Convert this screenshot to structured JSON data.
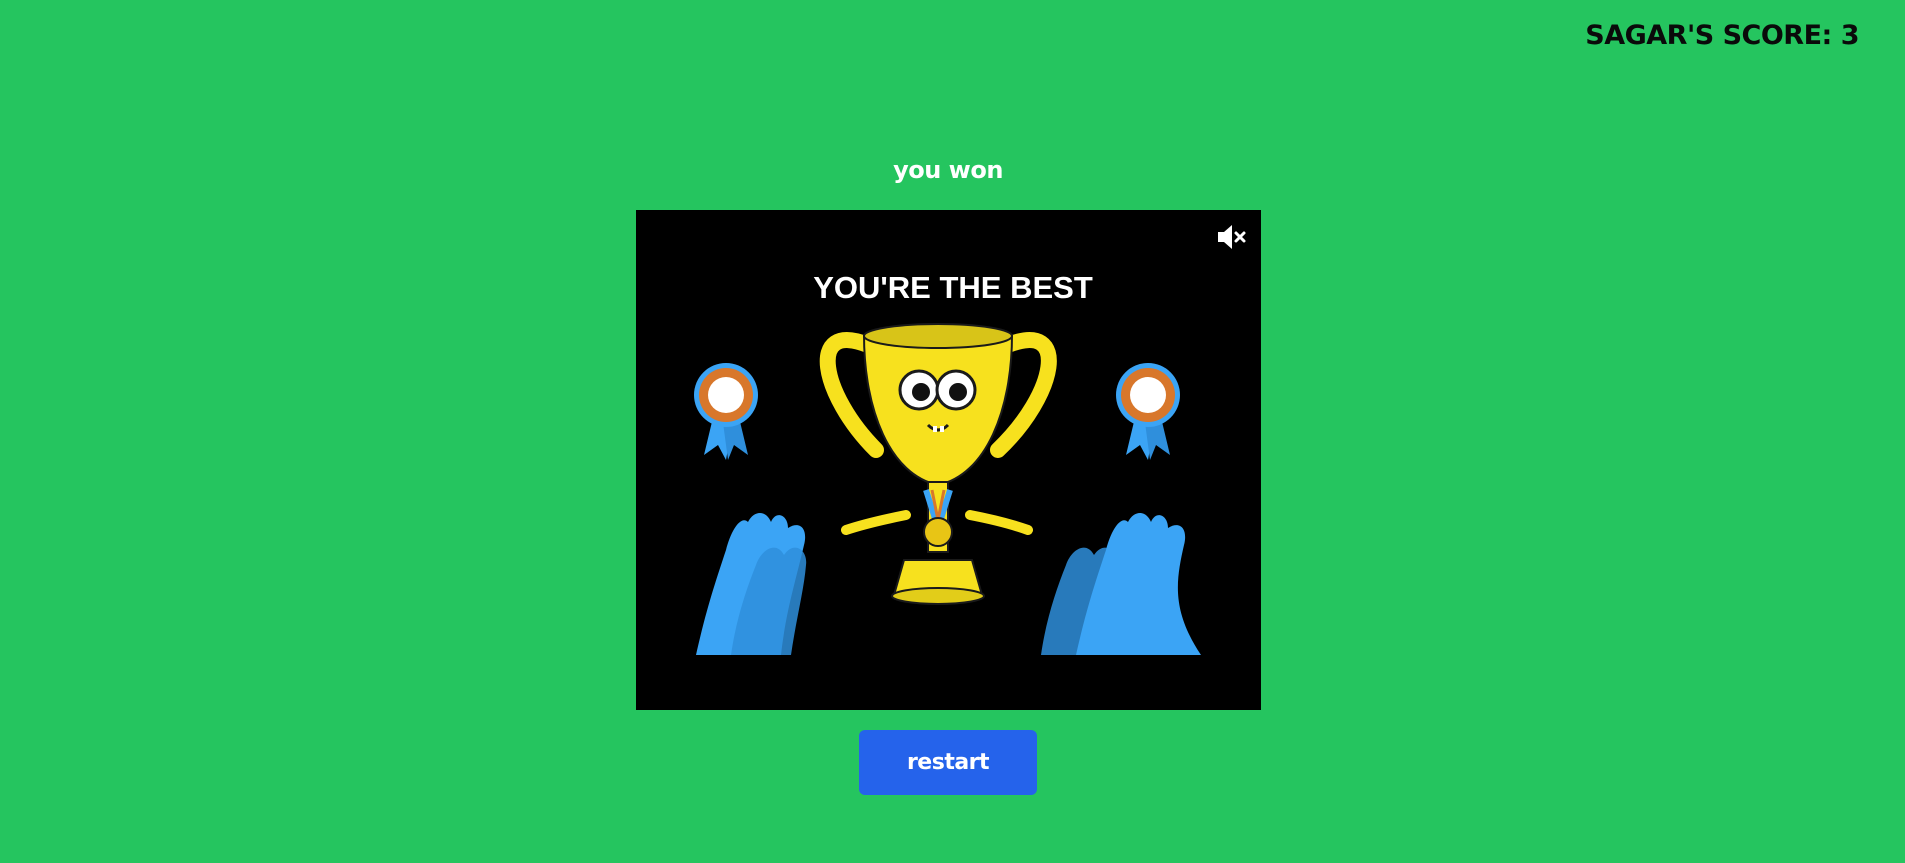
{
  "header": {
    "score_label": "SAGAR'S SCORE: 3"
  },
  "result": {
    "title": "you won"
  },
  "celebration": {
    "caption": "YOU'RE THE BEST",
    "mute_icon": "speaker-muted-icon"
  },
  "actions": {
    "restart_label": "restart"
  },
  "colors": {
    "background": "#25c55f",
    "button": "#2563eb",
    "trophy": "#f7e11e",
    "hands": "#3ba4f5"
  }
}
